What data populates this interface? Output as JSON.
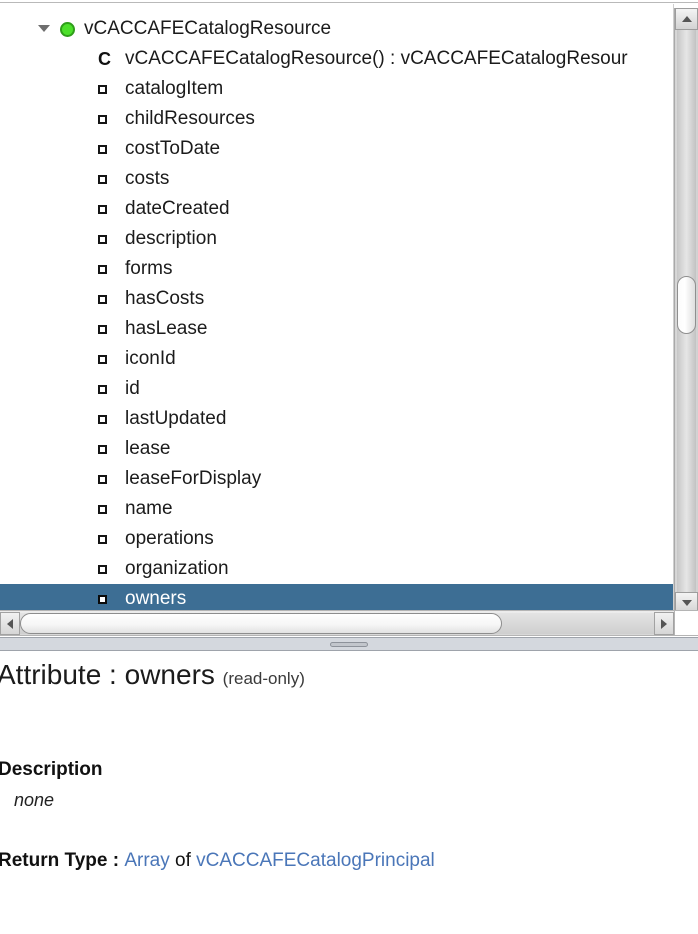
{
  "tree": {
    "root": {
      "label": "vCACCAFECatalogResource",
      "icon": "green-circle-icon",
      "twisty": "triangle-down-icon",
      "expanded": true
    },
    "items": [
      {
        "label": "vCACCAFECatalogResource() : vCACCAFECatalogResour",
        "icon": "constructor-c-icon",
        "kind": "constructor",
        "selected": false
      },
      {
        "label": "catalogItem",
        "icon": "attribute-square-icon",
        "kind": "attribute",
        "selected": false
      },
      {
        "label": "childResources",
        "icon": "attribute-square-icon",
        "kind": "attribute",
        "selected": false
      },
      {
        "label": "costToDate",
        "icon": "attribute-square-icon",
        "kind": "attribute",
        "selected": false
      },
      {
        "label": "costs",
        "icon": "attribute-square-icon",
        "kind": "attribute",
        "selected": false
      },
      {
        "label": "dateCreated",
        "icon": "attribute-square-icon",
        "kind": "attribute",
        "selected": false
      },
      {
        "label": "description",
        "icon": "attribute-square-icon",
        "kind": "attribute",
        "selected": false
      },
      {
        "label": "forms",
        "icon": "attribute-square-icon",
        "kind": "attribute",
        "selected": false
      },
      {
        "label": "hasCosts",
        "icon": "attribute-square-icon",
        "kind": "attribute",
        "selected": false
      },
      {
        "label": "hasLease",
        "icon": "attribute-square-icon",
        "kind": "attribute",
        "selected": false
      },
      {
        "label": "iconId",
        "icon": "attribute-square-icon",
        "kind": "attribute",
        "selected": false
      },
      {
        "label": "id",
        "icon": "attribute-square-icon",
        "kind": "attribute",
        "selected": false
      },
      {
        "label": "lastUpdated",
        "icon": "attribute-square-icon",
        "kind": "attribute",
        "selected": false
      },
      {
        "label": "lease",
        "icon": "attribute-square-icon",
        "kind": "attribute",
        "selected": false
      },
      {
        "label": "leaseForDisplay",
        "icon": "attribute-square-icon",
        "kind": "attribute",
        "selected": false
      },
      {
        "label": "name",
        "icon": "attribute-square-icon",
        "kind": "attribute",
        "selected": false
      },
      {
        "label": "operations",
        "icon": "attribute-square-icon",
        "kind": "attribute",
        "selected": false
      },
      {
        "label": "organization",
        "icon": "attribute-square-icon",
        "kind": "attribute",
        "selected": false
      },
      {
        "label": "owners",
        "icon": "attribute-square-icon",
        "kind": "attribute",
        "selected": true
      }
    ],
    "selection_color": "#3d6e94",
    "selection_text_color": "#ffffff"
  },
  "scrollbars": {
    "vertical": {
      "up_arrow": "triangle-up-icon",
      "down_arrow": "triangle-down-icon"
    },
    "horizontal": {
      "left_arrow": "triangle-left-icon",
      "right_arrow": "triangle-right-icon"
    }
  },
  "splitter": {
    "grip": "splitter-grip-icon"
  },
  "detail": {
    "title_prefix": "Attribute : ",
    "title_name": "owners",
    "title_flag": "(read-only)",
    "description_heading": "Description",
    "description_value": "none",
    "return_type_label": "Return Type : ",
    "return_type_array": "Array",
    "return_type_of": " of ",
    "return_type_class": "vCACCAFECatalogPrincipal",
    "link_color": "#4a76b8"
  }
}
